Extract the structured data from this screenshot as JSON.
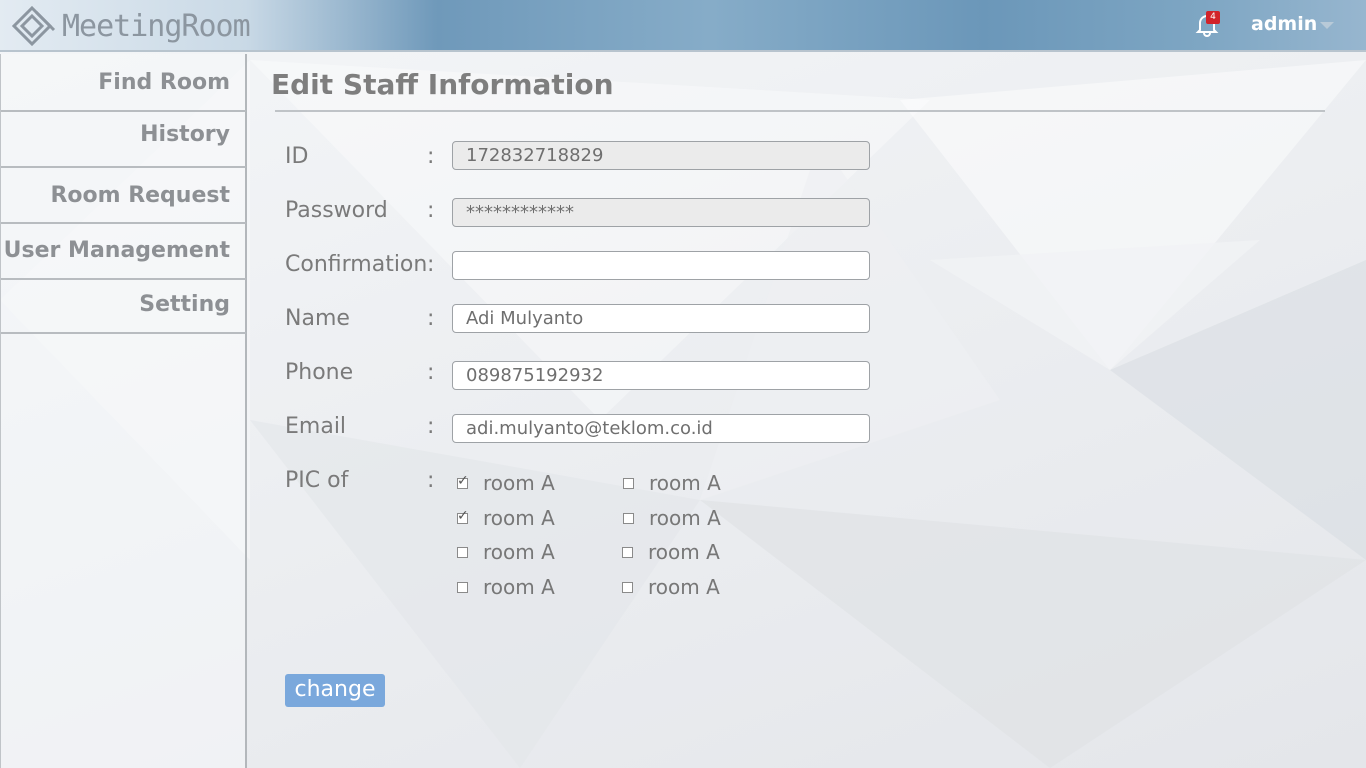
{
  "app": {
    "name": "MeetingRoom"
  },
  "header": {
    "notification_count": "4",
    "user": "admin",
    "icons": {
      "bell": "bell-icon",
      "caret": "chevron-down-icon",
      "logo": "diamond-logo-icon"
    }
  },
  "sidebar": {
    "items": [
      {
        "label": "Find Room"
      },
      {
        "label": "History"
      },
      {
        "label": "Room Request"
      },
      {
        "label": "User Management"
      },
      {
        "label": "Setting"
      }
    ]
  },
  "form": {
    "title": "Edit Staff Information",
    "fields": [
      {
        "label": "ID",
        "value": "172832718829",
        "readonly": true
      },
      {
        "label": "Password",
        "value": "************",
        "readonly": true
      },
      {
        "label": "Confirmation",
        "value": "",
        "readonly": false
      },
      {
        "label": "Name",
        "value": "Adi Mulyanto",
        "readonly": false
      },
      {
        "label": "Phone",
        "value": "089875192932",
        "readonly": false
      },
      {
        "label": "Email",
        "value": "adi.mulyanto@teklom.co.id",
        "readonly": false
      }
    ],
    "pic": {
      "label": "PIC of",
      "rooms": [
        {
          "label": "room A",
          "checked": true
        },
        {
          "label": "room A",
          "checked": false
        },
        {
          "label": "room A",
          "checked": true
        },
        {
          "label": "room A",
          "checked": false
        },
        {
          "label": "room A",
          "checked": false
        },
        {
          "label": "room A",
          "checked": false
        },
        {
          "label": "room A",
          "checked": false
        },
        {
          "label": "room A",
          "checked": false
        }
      ]
    },
    "submit_label": "change"
  },
  "colors": {
    "accent": "#7aa8dc",
    "header": "#6f99ba",
    "badge": "#d2232a"
  }
}
